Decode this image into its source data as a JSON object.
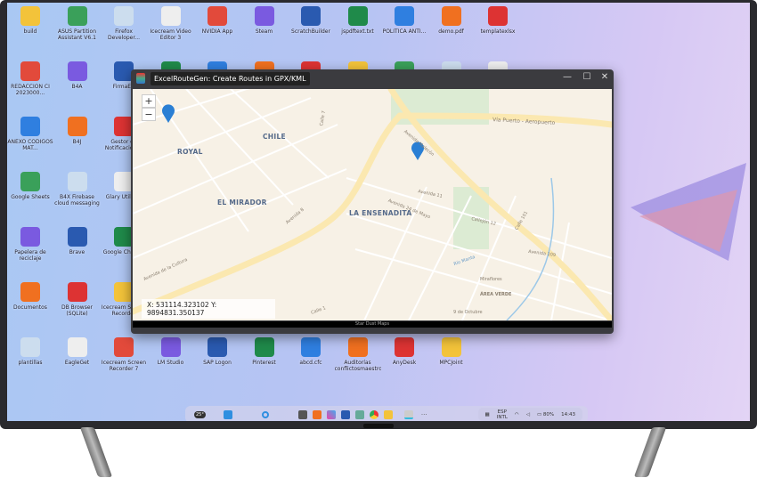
{
  "desktop": {
    "columns": [
      [
        "build",
        "REDACCIÓN CI 2023000...",
        "ANEXO CÓDIGOS MAT...",
        "Google Sheets",
        "Papelera de reciclaje",
        "Documentos",
        "plantillas"
      ],
      [
        "ASUS Partition Assistant V6.1",
        "B4A",
        "B4J",
        "B4X Firebase cloud messaging",
        "Brave",
        "DB Browser (SQLite)",
        "EagleGet"
      ],
      [
        "Firefox Developer...",
        "FirmaEC",
        "Gestor de Notificaciones",
        "Glary Utilities",
        "Google Chrome",
        "Icecream Screen Recorder",
        "Icecream Screen Recorder 7"
      ],
      [
        "Icecream Video Editor 3",
        "",
        null,
        null,
        null,
        null,
        "LM Studio"
      ],
      [
        "NVIDIA App",
        "",
        null,
        null,
        null,
        null,
        "SAP Logon"
      ],
      [
        "Steam",
        "",
        null,
        null,
        null,
        null,
        "Pinterest"
      ],
      [
        "ScratchBuilder",
        "",
        null,
        null,
        null,
        null,
        "abcd.cfc"
      ],
      [
        "jspdftext.txt",
        "",
        null,
        null,
        null,
        null,
        "Auditorías conflictosmaestros"
      ],
      [
        "POLITICA ANTI...",
        "",
        null,
        null,
        null,
        null,
        "AnyDesk"
      ],
      [
        "demo.pdf",
        "",
        null,
        null,
        null,
        null,
        "MPCJoint"
      ],
      [
        "templatexlsx",
        "",
        null,
        null,
        null,
        null,
        null
      ]
    ]
  },
  "window": {
    "title": "ExcelRouteGen: Create Routes in GPX/KML",
    "minimize": "—",
    "maximize": "☐",
    "close": "✕",
    "map": {
      "zoom_in": "+",
      "zoom_out": "−",
      "places": [
        "CHILE",
        "ROYAL",
        "EL MIRADOR",
        "LA ENSENADITA"
      ],
      "streets": [
        "Vía Puerto - Aeropuerto",
        "Avenida Malecón",
        "Avenida de la Cultura",
        "Avenida 24 de Mayo",
        "Avenida 8",
        "Avenida 11",
        "Callejón 12",
        "Calle 7",
        "Avenida 109",
        "Calle 101",
        "Miraflores",
        "ÁREA VERDE",
        "9 de Octubre",
        "Calle 1",
        "Río Manta"
      ],
      "coords": "X: 531114.323102  Y: 9894831.350137",
      "marker_color": "#2a7fd4"
    },
    "status": "Star Dust Maps"
  },
  "taskbar": {
    "weather": "25°",
    "lang": "ESP",
    "layout": "INTL",
    "battery": "80%",
    "time": "14:43",
    "more": "···"
  }
}
